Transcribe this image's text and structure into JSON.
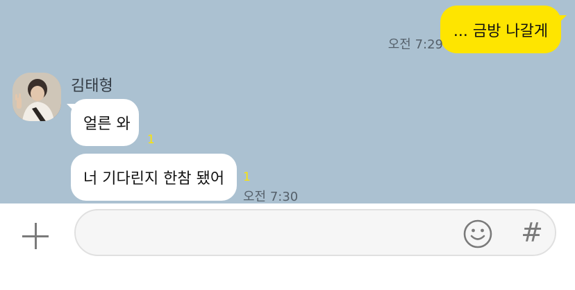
{
  "messages": {
    "outgoing": {
      "text": "... 금방 나갈게",
      "time": "오전 7:29"
    },
    "incoming": {
      "sender": "김태형",
      "avatar": "profile-photo",
      "items": [
        {
          "text": "얼른 와",
          "unread": "1"
        },
        {
          "text": "너 기다린지 한참 됐어",
          "unread": "1"
        }
      ],
      "time": "오전 7:30"
    }
  },
  "input": {
    "placeholder": "",
    "emoji_icon": "smiley-icon",
    "hash_icon": "#",
    "plus_icon": "plus-icon"
  },
  "colors": {
    "chat_background": "#abc1d1",
    "outgoing_bubble": "#fee500",
    "incoming_bubble": "#ffffff",
    "unread_count": "#fee500"
  }
}
